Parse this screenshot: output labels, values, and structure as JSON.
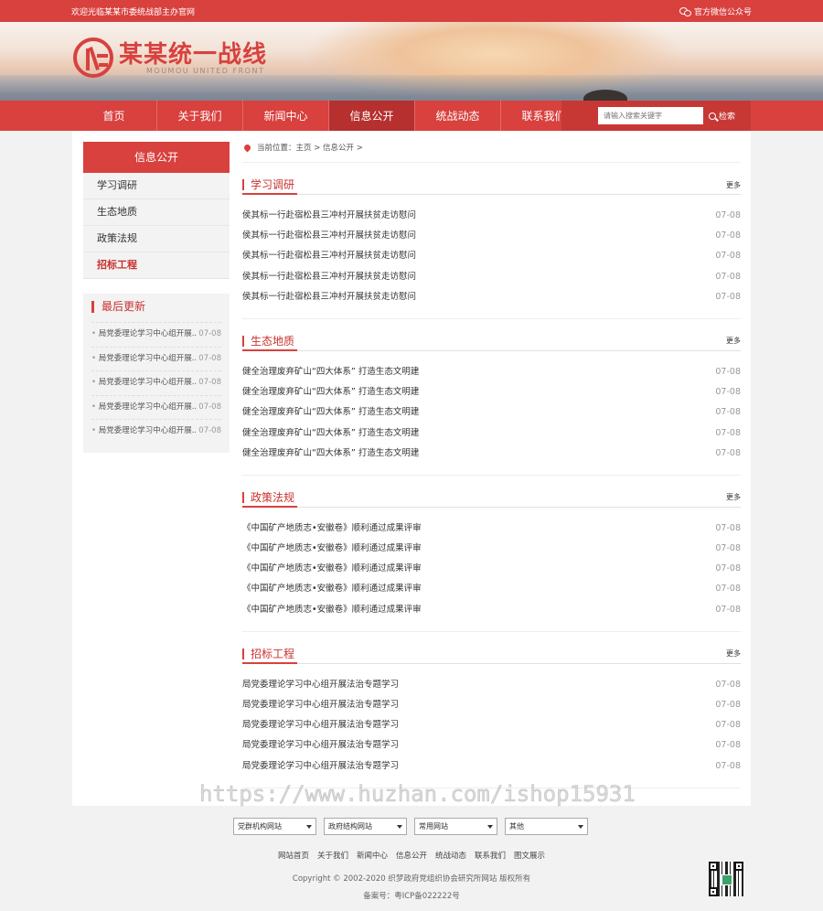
{
  "topbar": {
    "welcome": "欢迎光临某某市委统战部主办官网",
    "wechat": "官方微信公众号"
  },
  "logo": {
    "cn": "某某统一战线",
    "en": "MOUMOU UNITED FRONT"
  },
  "nav": {
    "items": [
      {
        "label": "首页"
      },
      {
        "label": "关于我们"
      },
      {
        "label": "新闻中心"
      },
      {
        "label": "信息公开"
      },
      {
        "label": "统战动态"
      },
      {
        "label": "联系我们"
      }
    ],
    "search_placeholder": "请输入搜索关键字",
    "search_label": "检索"
  },
  "sidebar": {
    "title": "信息公开",
    "menu": [
      {
        "label": "学习调研"
      },
      {
        "label": "生态地质"
      },
      {
        "label": "政策法规"
      },
      {
        "label": "招标工程"
      }
    ],
    "updates_title": "最后更新",
    "updates": [
      {
        "title": "局党委理论学习中心组开展...",
        "date": "07-08"
      },
      {
        "title": "局党委理论学习中心组开展...",
        "date": "07-08"
      },
      {
        "title": "局党委理论学习中心组开展...",
        "date": "07-08"
      },
      {
        "title": "局党委理论学习中心组开展...",
        "date": "07-08"
      },
      {
        "title": "局党委理论学习中心组开展...",
        "date": "07-08"
      }
    ]
  },
  "breadcrumb": {
    "text": "当前位置：主页 > 信息公开 >"
  },
  "sections": [
    {
      "title": "学习调研",
      "more": "更多",
      "items": [
        {
          "title": "侯其标一行赴宿松县三冲村开展扶贫走访慰问",
          "date": "07-08"
        },
        {
          "title": "侯其标一行赴宿松县三冲村开展扶贫走访慰问",
          "date": "07-08"
        },
        {
          "title": "侯其标一行赴宿松县三冲村开展扶贫走访慰问",
          "date": "07-08"
        },
        {
          "title": "侯其标一行赴宿松县三冲村开展扶贫走访慰问",
          "date": "07-08"
        },
        {
          "title": "侯其标一行赴宿松县三冲村开展扶贫走访慰问",
          "date": "07-08"
        }
      ]
    },
    {
      "title": "生态地质",
      "more": "更多",
      "items": [
        {
          "title": "健全治理废弃矿山“四大体系” 打造生态文明建",
          "date": "07-08"
        },
        {
          "title": "健全治理废弃矿山“四大体系” 打造生态文明建",
          "date": "07-08"
        },
        {
          "title": "健全治理废弃矿山“四大体系” 打造生态文明建",
          "date": "07-08"
        },
        {
          "title": "健全治理废弃矿山“四大体系” 打造生态文明建",
          "date": "07-08"
        },
        {
          "title": "健全治理废弃矿山“四大体系” 打造生态文明建",
          "date": "07-08"
        }
      ]
    },
    {
      "title": "政策法规",
      "more": "更多",
      "items": [
        {
          "title": "《中国矿产地质志•安徽卷》顺利通过成果评审",
          "date": "07-08"
        },
        {
          "title": "《中国矿产地质志•安徽卷》顺利通过成果评审",
          "date": "07-08"
        },
        {
          "title": "《中国矿产地质志•安徽卷》顺利通过成果评审",
          "date": "07-08"
        },
        {
          "title": "《中国矿产地质志•安徽卷》顺利通过成果评审",
          "date": "07-08"
        },
        {
          "title": "《中国矿产地质志•安徽卷》顺利通过成果评审",
          "date": "07-08"
        }
      ]
    },
    {
      "title": "招标工程",
      "more": "更多",
      "items": [
        {
          "title": "局党委理论学习中心组开展法治专题学习",
          "date": "07-08"
        },
        {
          "title": "局党委理论学习中心组开展法治专题学习",
          "date": "07-08"
        },
        {
          "title": "局党委理论学习中心组开展法治专题学习",
          "date": "07-08"
        },
        {
          "title": "局党委理论学习中心组开展法治专题学习",
          "date": "07-08"
        },
        {
          "title": "局党委理论学习中心组开展法治专题学习",
          "date": "07-08"
        }
      ]
    }
  ],
  "watermark": "https://www.huzhan.com/ishop15931",
  "footer": {
    "selects": [
      {
        "label": "党群机构网站"
      },
      {
        "label": "政府结构网站"
      },
      {
        "label": "常用网站"
      },
      {
        "label": "其他"
      }
    ],
    "links": [
      {
        "label": "网站首页"
      },
      {
        "label": "关于我们"
      },
      {
        "label": "新闻中心"
      },
      {
        "label": "信息公开"
      },
      {
        "label": "统战动态"
      },
      {
        "label": "联系我们"
      },
      {
        "label": "图文展示"
      }
    ],
    "copyright": "Copyright © 2002-2020 织梦政府党组织协会研究所网站 版权所有",
    "icp": "备案号：粤ICP备022222号"
  },
  "colors": {
    "brand": "#d8413e",
    "active": "#b5302e"
  }
}
